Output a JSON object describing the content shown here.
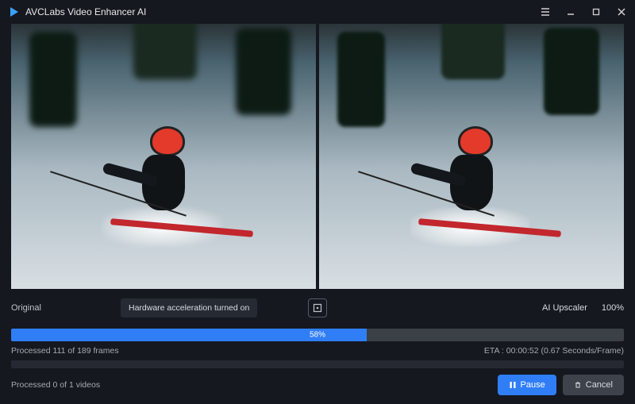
{
  "app": {
    "title": "AVCLabs Video Enhancer AI"
  },
  "preview": {
    "left_label": "Original",
    "right_label": "AI Upscaler",
    "zoom_pct": "100%"
  },
  "tooltip": {
    "text": "Hardware acceleration turned on"
  },
  "progress": {
    "percent": 58,
    "percent_label": "58%",
    "frames_text": "Processed 111 of 189 frames",
    "eta_text": "ETA : 00:00:52 (0.67 Seconds/Frame)"
  },
  "queue": {
    "videos_text": "Processed 0 of 1 videos"
  },
  "buttons": {
    "pause": "Pause",
    "cancel": "Cancel"
  }
}
